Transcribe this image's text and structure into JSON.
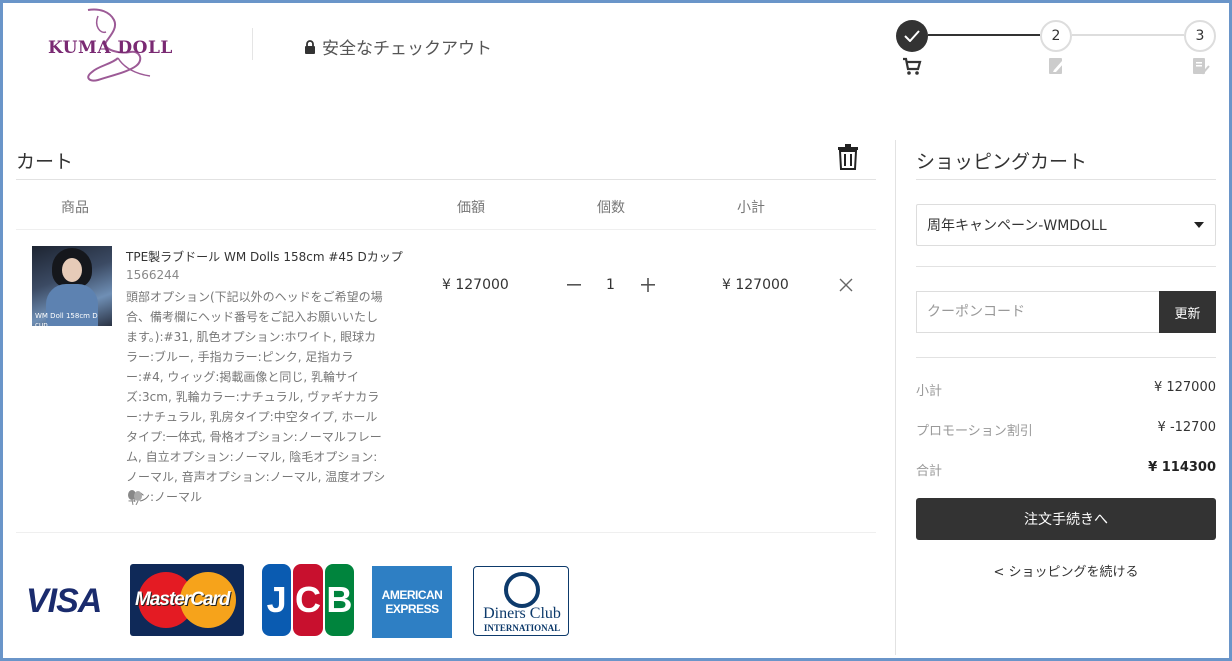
{
  "header": {
    "logo_text": "KUMA DOLL",
    "secure_checkout": "安全なチェックアウト"
  },
  "steps": {
    "step2": "2",
    "step3": "3",
    "active_color": "#333333"
  },
  "cart": {
    "title": "カート",
    "columns": {
      "product": "商品",
      "price": "価額",
      "quantity": "個数",
      "subtotal": "小計"
    },
    "item": {
      "name": "TPE製ラブドール WM Dolls 158cm #45 Dカップ",
      "sku": "1566244",
      "image_caption": "WM Doll 158cm D cup",
      "options": "頭部オプション(下記以外のヘッドをご希望の場合、備考欄にヘッド番号をご記入お願いいたします。):#31, 肌色オプション:ホワイト, 眼球カラー:ブルー, 手指カラー:ピンク, 足指カラー:#4, ウィッグ:掲載画像と同じ, 乳輪サイズ:3cm, 乳輪カラー:ナチュラル, ヴァギナカラー:ナチュラル, 乳房タイプ:中空タイプ, ホールタイプ:一体式, 骨格オプション:ノーマルフレーム, 自立オプション:ノーマル, 陰毛オプション:ノーマル, 音声オプション:ノーマル, 温度オプション:ノーマル",
      "price": "¥ 127000",
      "quantity": "1",
      "subtotal": "¥ 127000"
    },
    "payment_cards": {
      "visa": "VISA",
      "mastercard": "MasterCard",
      "jcb": [
        "J",
        "C",
        "B"
      ],
      "amex_line1": "AMERICAN",
      "amex_line2": "EXPRESS",
      "diners_line1": "Diners Club",
      "diners_line2": "INTERNATIONAL"
    }
  },
  "summary": {
    "title": "ショッピングカート",
    "promotion_select": "周年キャンペーン-WMDOLL",
    "coupon_placeholder": "クーポンコード",
    "update_label": "更新",
    "subtotal_label": "小計",
    "subtotal_value": "¥ 127000",
    "promo_label": "プロモーション割引",
    "promo_value": "¥ -12700",
    "total_label": "合計",
    "total_value": "¥ 114300",
    "checkout_label": "注文手続きへ",
    "continue_label": "< ショッピングを続ける"
  }
}
